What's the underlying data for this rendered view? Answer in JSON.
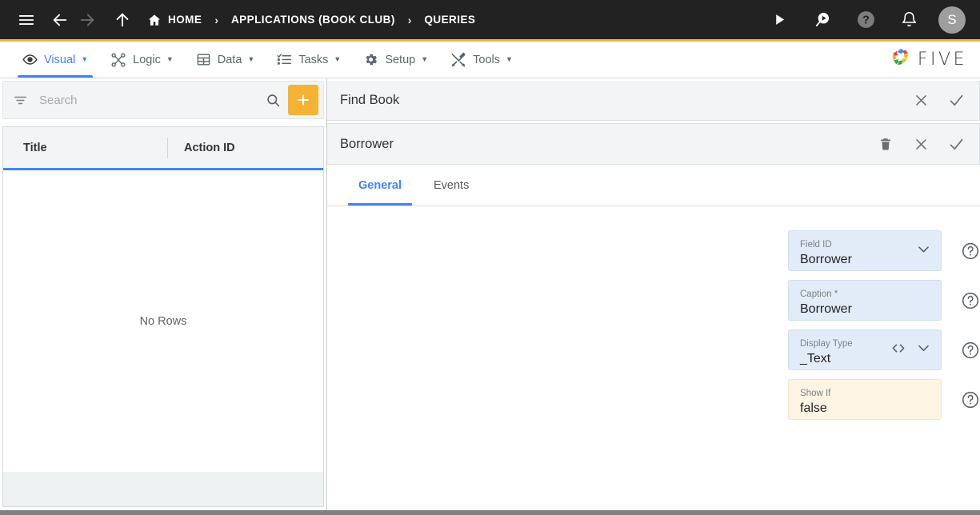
{
  "topbar": {
    "menu_icon": "hamburger-icon",
    "back_icon": "arrow-left-icon",
    "forward_icon": "arrow-right-icon",
    "up_icon": "arrow-up-icon",
    "breadcrumbs": [
      {
        "label": "HOME",
        "icon": "home-icon"
      },
      {
        "label": "APPLICATIONS (BOOK CLUB)",
        "icon": ""
      },
      {
        "label": "QUERIES",
        "icon": ""
      }
    ],
    "separator": "›",
    "actions": [
      {
        "name": "run-icon",
        "label": ""
      },
      {
        "name": "search-play-icon",
        "label": ""
      },
      {
        "name": "help-icon",
        "label": ""
      },
      {
        "name": "notifications-bell-icon",
        "label": ""
      }
    ],
    "avatar_initial": "S",
    "accent_color": "#F5B335",
    "background_color": "#222222"
  },
  "menubar": {
    "items": [
      {
        "label": "Visual",
        "icon": "eye-icon",
        "caret": "▼",
        "active": true
      },
      {
        "label": "Logic",
        "icon": "logic-nodes-icon",
        "caret": "▼",
        "active": false
      },
      {
        "label": "Data",
        "icon": "table-grid-icon",
        "caret": "▼",
        "active": false
      },
      {
        "label": "Tasks",
        "icon": "checklist-icon",
        "caret": "▼",
        "active": false
      },
      {
        "label": "Setup",
        "icon": "gear-icon",
        "caret": "▼",
        "active": false
      },
      {
        "label": "Tools",
        "icon": "tools-wrench-icon",
        "caret": "▼",
        "active": false
      }
    ],
    "brand": "FIVE",
    "active_color": "#4285F4"
  },
  "sidebar": {
    "search": {
      "placeholder": "Search",
      "value": ""
    },
    "filter_icon": "filter-icon",
    "search_icon": "search-icon",
    "add_button_label": "+",
    "grid": {
      "columns": [
        "Title",
        "Action ID"
      ],
      "rows": [],
      "empty_message": "No Rows"
    }
  },
  "main": {
    "parent_card": {
      "title": "Find Book",
      "actions": [
        {
          "name": "close-icon",
          "glyph": "✕"
        },
        {
          "name": "confirm-check-icon",
          "glyph": "✓"
        }
      ]
    },
    "child_card": {
      "title": "Borrower",
      "actions": [
        {
          "name": "delete-trash-icon",
          "glyph": ""
        },
        {
          "name": "close-icon",
          "glyph": "✕"
        },
        {
          "name": "confirm-check-icon",
          "glyph": "✓"
        }
      ]
    },
    "tabs": [
      {
        "label": "General",
        "active": true
      },
      {
        "label": "Events",
        "active": false
      }
    ],
    "fields": [
      {
        "label": "Field ID",
        "value": "Borrower",
        "style": "blue",
        "adornments": [
          "chevron-down-icon"
        ],
        "help": "help-circle-icon"
      },
      {
        "label": "Caption *",
        "value": "Borrower",
        "style": "blue",
        "adornments": [],
        "help": "help-circle-icon"
      },
      {
        "label": "Display Type",
        "value": "_Text",
        "style": "blue",
        "adornments": [
          "code-brackets-icon",
          "chevron-down-icon"
        ],
        "help": "help-circle-icon"
      },
      {
        "label": "Show If",
        "value": "false",
        "style": "cream",
        "adornments": [],
        "help": "help-circle-icon"
      }
    ]
  }
}
